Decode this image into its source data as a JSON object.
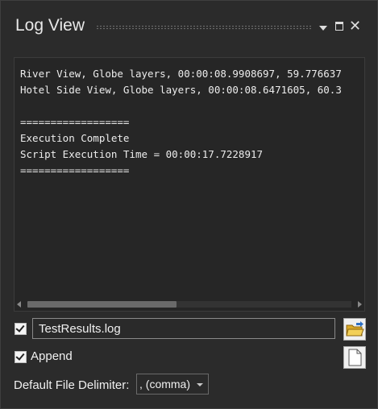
{
  "panel": {
    "title": "Log View"
  },
  "log": {
    "lines": [
      "River View, Globe layers, 00:00:08.9908697, 59.776637",
      "Hotel Side View, Globe layers, 00:00:08.6471605, 60.3",
      "",
      "==================",
      "Execution Complete",
      "Script Execution Time = 00:00:17.7228917",
      "=================="
    ]
  },
  "output": {
    "write_to_file_checked": true,
    "file_name": "TestResults.log",
    "append_checked": true,
    "append_label": "Append",
    "delimiter_label": "Default File Delimiter:",
    "delimiter_value": ", (comma)"
  },
  "icons": {
    "folder": "open-folder-icon",
    "new_file": "new-file-icon"
  }
}
